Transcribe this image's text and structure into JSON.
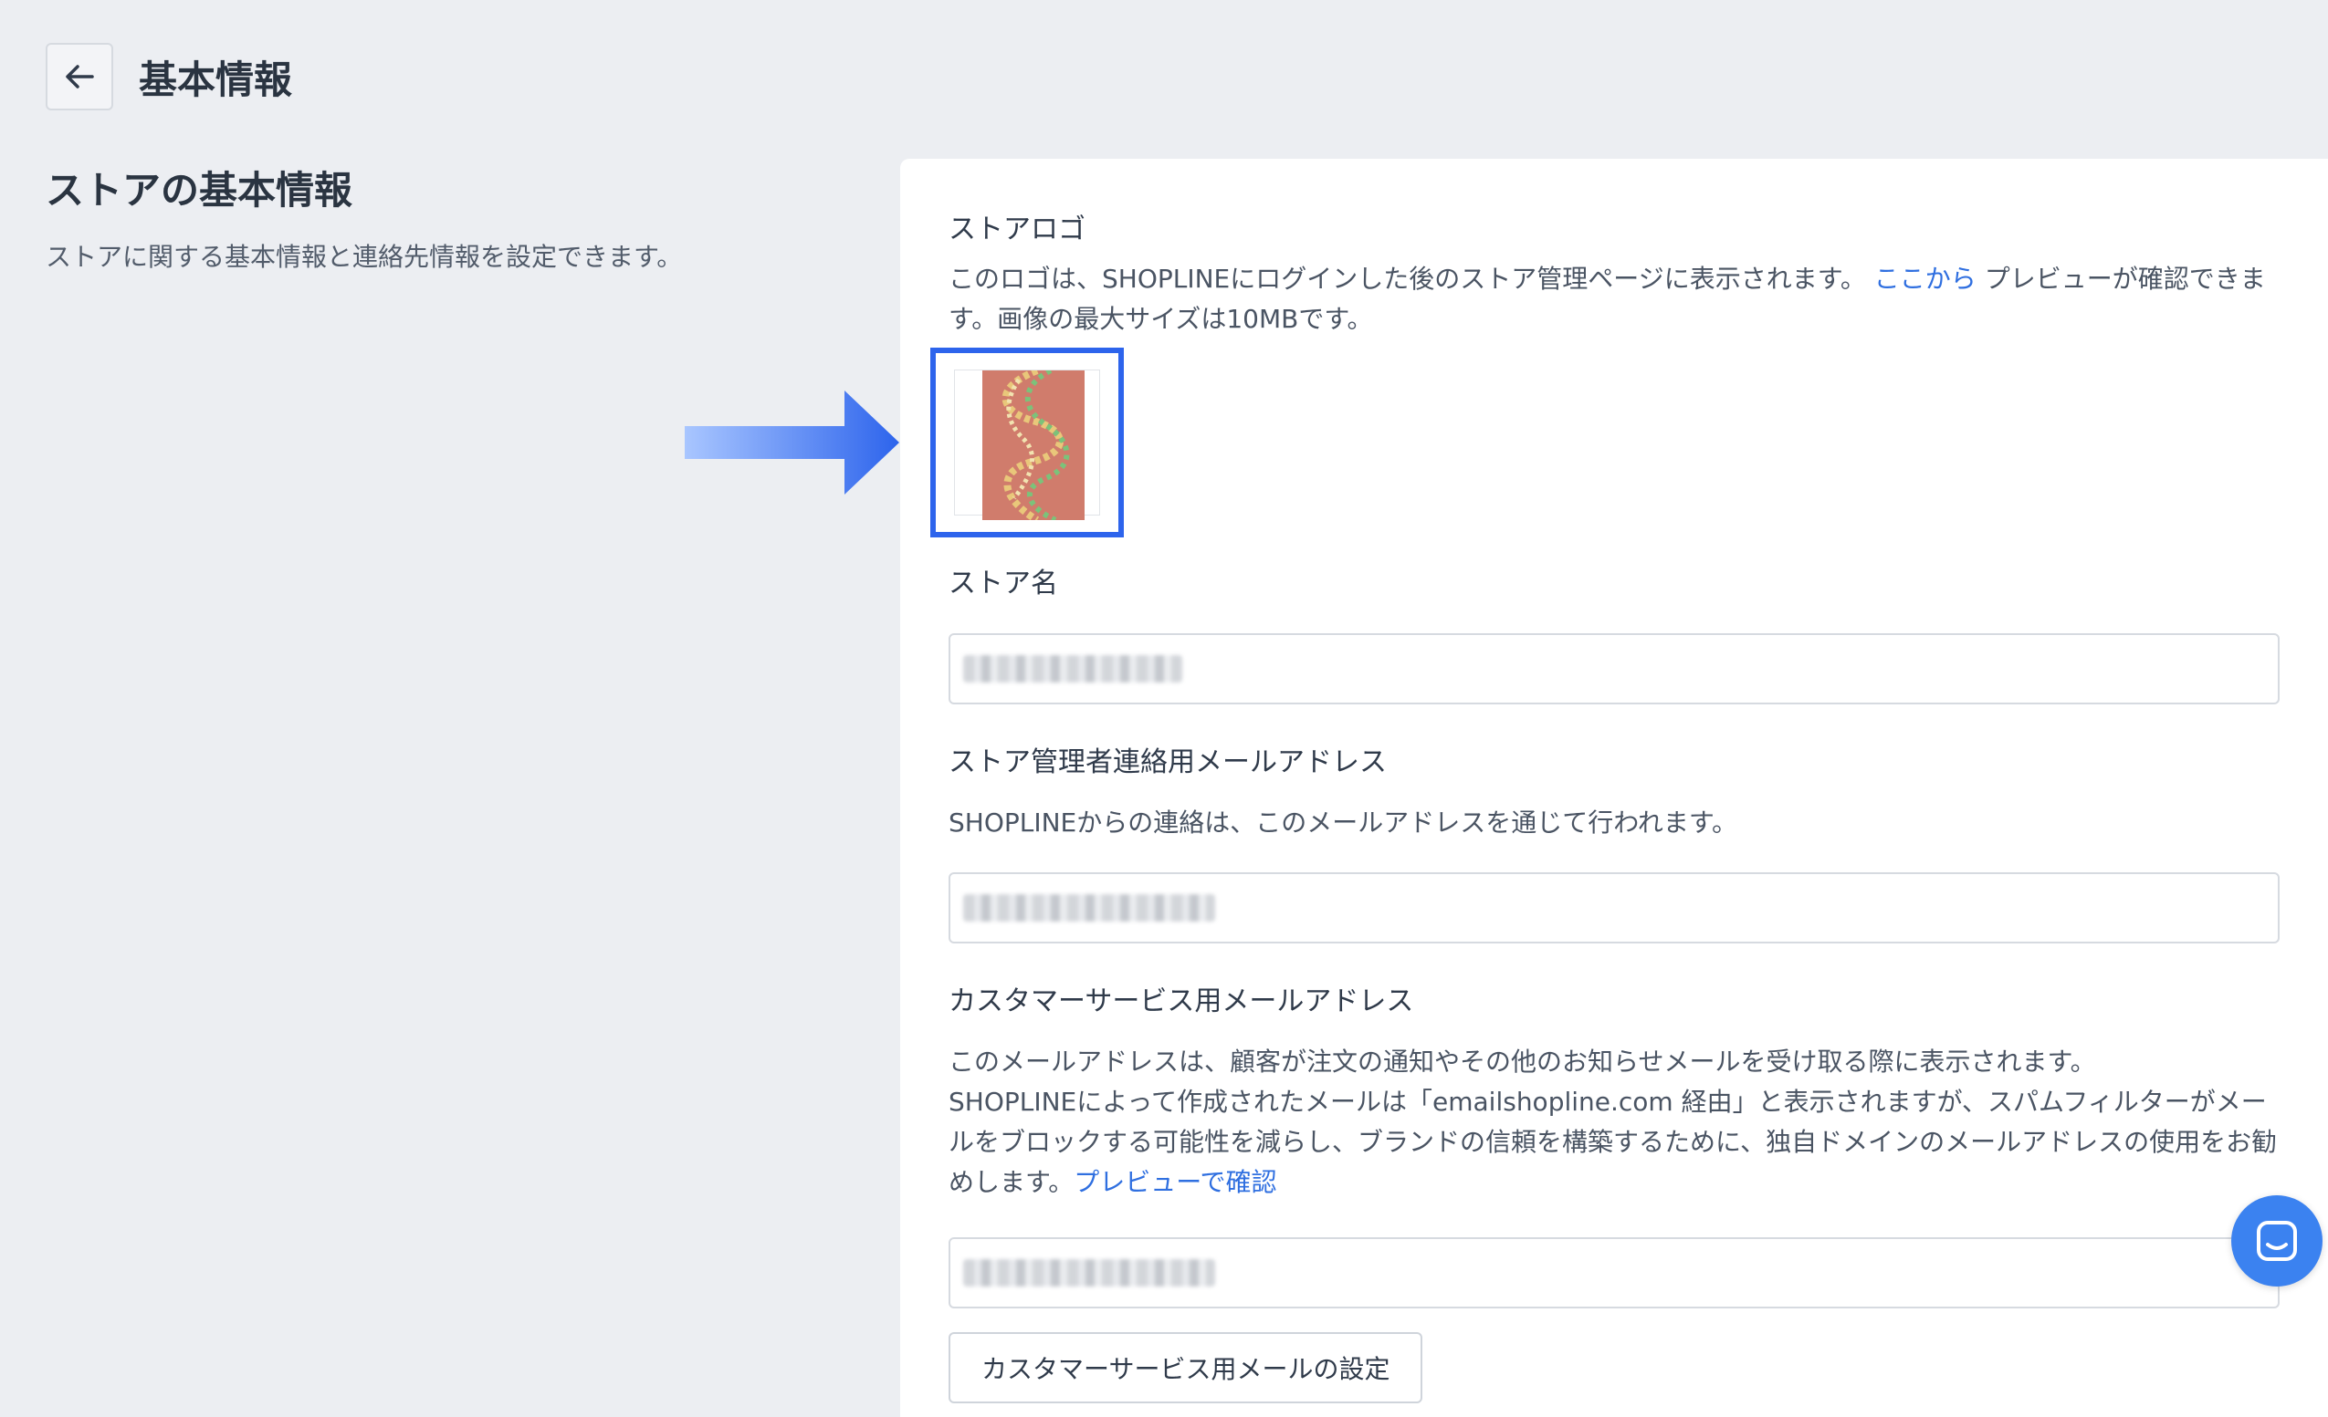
{
  "header": {
    "title": "基本情報"
  },
  "left": {
    "section_title": "ストアの基本情報",
    "section_desc": "ストアに関する基本情報と連絡先情報を設定できます。"
  },
  "store_logo": {
    "label": "ストアロゴ",
    "help_prefix": "このロゴは、SHOPLINEにログインした後のストア管理ページに表示されます。",
    "help_link": "ここから",
    "help_suffix": "プレビューが確認できます。画像の最大サイズは10MBです。"
  },
  "store_name": {
    "label": "ストア名"
  },
  "admin_email": {
    "label": "ストア管理者連絡用メールアドレス",
    "help": "SHOPLINEからの連絡は、このメールアドレスを通じて行われます。"
  },
  "cs_email": {
    "label": "カスタマーサービス用メールアドレス",
    "help_line1": "このメールアドレスは、顧客が注文の通知やその他のお知らせメールを受け取る際に表示されます。",
    "help_line2": "SHOPLINEによって作成されたメールは「emailshopline.com 経由」と表示されますが、スパムフィルターがメールをブロックする可能性を減らし、ブランドの信頼を構築するために、独自ドメインのメールアドレスの使用をお勧めします。",
    "help_link": "プレビューで確認",
    "button_label": "カスタマーサービス用メールの設定"
  },
  "icons": {
    "back": "arrow-left-icon",
    "chat": "chat-icon",
    "pointer": "arrow-right-icon"
  },
  "colors": {
    "accent": "#2d64ec",
    "link": "#2f6fe0",
    "background": "#eceef2"
  }
}
